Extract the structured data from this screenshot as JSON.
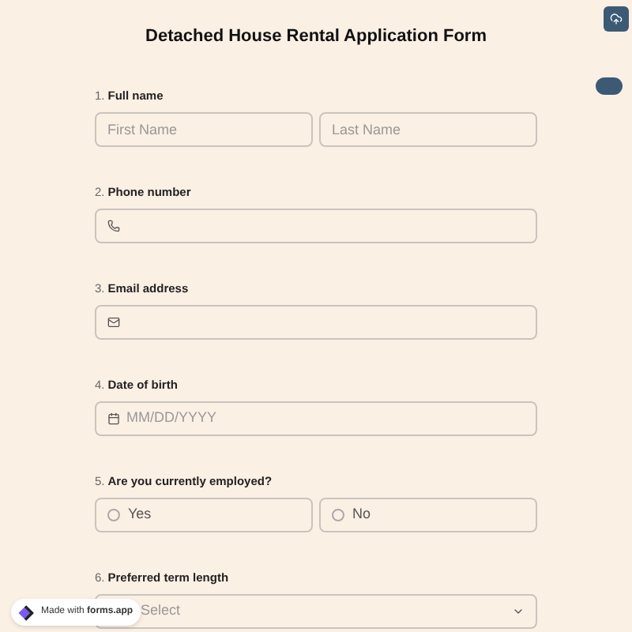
{
  "title": "Detached House Rental Application Form",
  "questions": [
    {
      "number": "1.",
      "label": "Full name",
      "kind": "name",
      "fields": [
        {
          "placeholder": "First Name"
        },
        {
          "placeholder": "Last Name"
        }
      ]
    },
    {
      "number": "2.",
      "label": "Phone number",
      "kind": "phone"
    },
    {
      "number": "3.",
      "label": "Email address",
      "kind": "email"
    },
    {
      "number": "4.",
      "label": "Date of birth",
      "kind": "date",
      "placeholder": "MM/DD/YYYY"
    },
    {
      "number": "5.",
      "label": "Are you currently employed?",
      "kind": "choice",
      "options": [
        {
          "label": "Yes",
          "selected": false
        },
        {
          "label": "No",
          "selected": false
        }
      ]
    },
    {
      "number": "6.",
      "label": "Preferred term length",
      "kind": "select",
      "placeholder": "Select"
    }
  ],
  "badge": {
    "prefix": "Made with",
    "brand": "forms.app"
  }
}
